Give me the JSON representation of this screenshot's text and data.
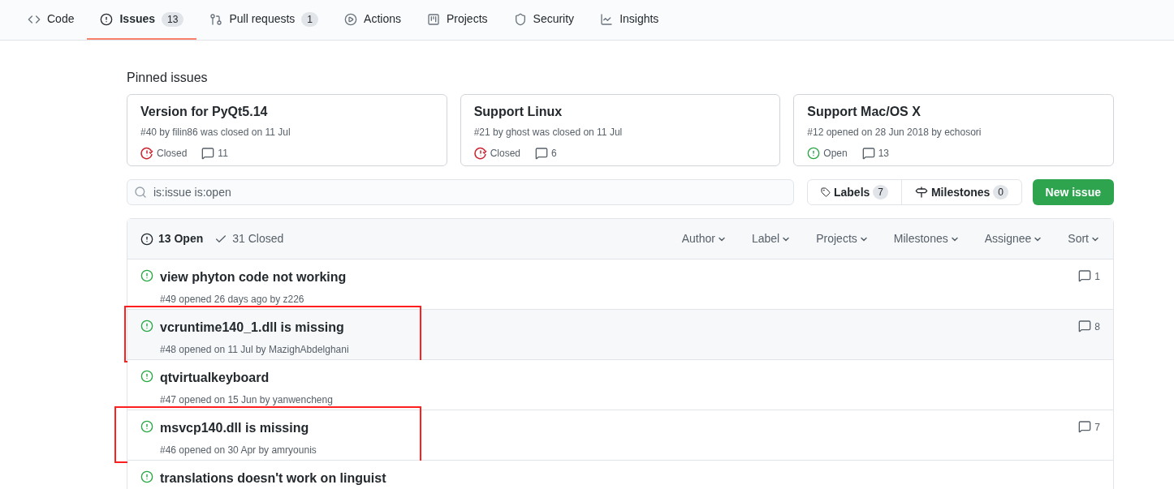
{
  "tabs": [
    {
      "kind": "code",
      "label": "Code",
      "selected": false
    },
    {
      "kind": "issues",
      "label": "Issues",
      "count": "13",
      "selected": true
    },
    {
      "kind": "pulls",
      "label": "Pull requests",
      "count": "1",
      "selected": false
    },
    {
      "kind": "actions",
      "label": "Actions",
      "selected": false
    },
    {
      "kind": "projects",
      "label": "Projects",
      "selected": false
    },
    {
      "kind": "security",
      "label": "Security",
      "selected": false
    },
    {
      "kind": "insights",
      "label": "Insights",
      "selected": false
    }
  ],
  "pinned": {
    "heading": "Pinned issues",
    "cards": [
      {
        "title": "Version for PyQt5.14",
        "meta": "#40 by filin86 was closed on 11 Jul",
        "kind": "closed",
        "state_label": "Closed",
        "comments": "11"
      },
      {
        "title": "Support Linux",
        "meta": "#21 by ghost was closed on 11 Jul",
        "kind": "closed",
        "state_label": "Closed",
        "comments": "6"
      },
      {
        "title": "Support Mac/OS X",
        "meta": "#12 opened on 28 Jun 2018 by echosori",
        "kind": "open",
        "state_label": "Open",
        "comments": "13"
      }
    ]
  },
  "search": {
    "value": "is:issue is:open"
  },
  "labels": {
    "label": "Labels",
    "count": "7"
  },
  "milestones": {
    "label": "Milestones",
    "count": "0"
  },
  "new_issue": "New issue",
  "list_header": {
    "open": "13 Open",
    "closed": "31 Closed",
    "filters": [
      "Author",
      "Label",
      "Projects",
      "Milestones",
      "Assignee",
      "Sort"
    ]
  },
  "issues": [
    {
      "title": "view phyton code not working",
      "meta": "#49 opened 26 days ago by z226",
      "comments": "1",
      "hovered": false,
      "marked": false
    },
    {
      "title": "vcruntime140_1.dll is missing",
      "meta": "#48 opened on 11 Jul by MazighAbdelghani",
      "comments": "8",
      "hovered": true,
      "marked": true
    },
    {
      "title": "qtvirtualkeyboard",
      "meta": "#47 opened on 15 Jun by yanwencheng",
      "hovered": false,
      "marked": false
    },
    {
      "title": "msvcp140.dll is missing",
      "meta": "#46 opened on 30 Apr by amryounis",
      "comments": "7",
      "hovered": false,
      "marked": true
    },
    {
      "title": "translations doesn't work on linguist",
      "hovered": false,
      "marked": false
    }
  ]
}
